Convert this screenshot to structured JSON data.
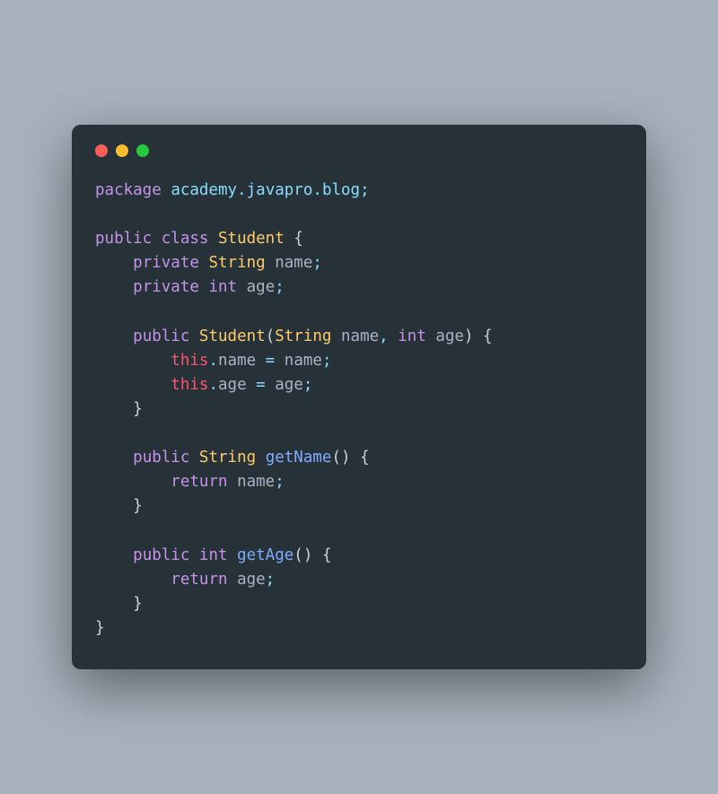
{
  "window": {
    "traffic_lights": [
      "close",
      "minimize",
      "zoom"
    ]
  },
  "code": {
    "tokens": [
      [
        {
          "t": "package",
          "c": "kw"
        },
        {
          "t": " ",
          "c": ""
        },
        {
          "t": "academy",
          "c": "pkg"
        },
        {
          "t": ".",
          "c": "punct"
        },
        {
          "t": "javapro",
          "c": "pkg"
        },
        {
          "t": ".",
          "c": "punct"
        },
        {
          "t": "blog",
          "c": "pkg"
        },
        {
          "t": ";",
          "c": "semi"
        }
      ],
      [],
      [
        {
          "t": "public",
          "c": "kw"
        },
        {
          "t": " ",
          "c": ""
        },
        {
          "t": "class",
          "c": "kw"
        },
        {
          "t": " ",
          "c": ""
        },
        {
          "t": "Student",
          "c": "type"
        },
        {
          "t": " ",
          "c": ""
        },
        {
          "t": "{",
          "c": "brace"
        }
      ],
      [
        {
          "t": "    ",
          "c": ""
        },
        {
          "t": "private",
          "c": "kw"
        },
        {
          "t": " ",
          "c": ""
        },
        {
          "t": "String",
          "c": "type"
        },
        {
          "t": " ",
          "c": ""
        },
        {
          "t": "name",
          "c": "ident"
        },
        {
          "t": ";",
          "c": "semi"
        }
      ],
      [
        {
          "t": "    ",
          "c": ""
        },
        {
          "t": "private",
          "c": "kw"
        },
        {
          "t": " ",
          "c": ""
        },
        {
          "t": "int",
          "c": "kw"
        },
        {
          "t": " ",
          "c": ""
        },
        {
          "t": "age",
          "c": "ident"
        },
        {
          "t": ";",
          "c": "semi"
        }
      ],
      [],
      [
        {
          "t": "    ",
          "c": ""
        },
        {
          "t": "public",
          "c": "kw"
        },
        {
          "t": " ",
          "c": ""
        },
        {
          "t": "Student",
          "c": "type"
        },
        {
          "t": "(",
          "c": "paren"
        },
        {
          "t": "String",
          "c": "type"
        },
        {
          "t": " ",
          "c": ""
        },
        {
          "t": "name",
          "c": "ident"
        },
        {
          "t": ",",
          "c": "punct"
        },
        {
          "t": " ",
          "c": ""
        },
        {
          "t": "int",
          "c": "kw"
        },
        {
          "t": " ",
          "c": ""
        },
        {
          "t": "age",
          "c": "ident"
        },
        {
          "t": ")",
          "c": "paren"
        },
        {
          "t": " ",
          "c": ""
        },
        {
          "t": "{",
          "c": "brace"
        }
      ],
      [
        {
          "t": "        ",
          "c": ""
        },
        {
          "t": "this",
          "c": "this"
        },
        {
          "t": ".",
          "c": "punct"
        },
        {
          "t": "name",
          "c": "ident"
        },
        {
          "t": " ",
          "c": ""
        },
        {
          "t": "=",
          "c": "op"
        },
        {
          "t": " ",
          "c": ""
        },
        {
          "t": "name",
          "c": "ident"
        },
        {
          "t": ";",
          "c": "semi"
        }
      ],
      [
        {
          "t": "        ",
          "c": ""
        },
        {
          "t": "this",
          "c": "this"
        },
        {
          "t": ".",
          "c": "punct"
        },
        {
          "t": "age",
          "c": "ident"
        },
        {
          "t": " ",
          "c": ""
        },
        {
          "t": "=",
          "c": "op"
        },
        {
          "t": " ",
          "c": ""
        },
        {
          "t": "age",
          "c": "ident"
        },
        {
          "t": ";",
          "c": "semi"
        }
      ],
      [
        {
          "t": "    ",
          "c": ""
        },
        {
          "t": "}",
          "c": "brace"
        }
      ],
      [],
      [
        {
          "t": "    ",
          "c": ""
        },
        {
          "t": "public",
          "c": "kw"
        },
        {
          "t": " ",
          "c": ""
        },
        {
          "t": "String",
          "c": "type"
        },
        {
          "t": " ",
          "c": ""
        },
        {
          "t": "getName",
          "c": "method"
        },
        {
          "t": "(",
          "c": "paren"
        },
        {
          "t": ")",
          "c": "paren"
        },
        {
          "t": " ",
          "c": ""
        },
        {
          "t": "{",
          "c": "brace"
        }
      ],
      [
        {
          "t": "        ",
          "c": ""
        },
        {
          "t": "return",
          "c": "kw"
        },
        {
          "t": " ",
          "c": ""
        },
        {
          "t": "name",
          "c": "ident"
        },
        {
          "t": ";",
          "c": "semi"
        }
      ],
      [
        {
          "t": "    ",
          "c": ""
        },
        {
          "t": "}",
          "c": "brace"
        }
      ],
      [],
      [
        {
          "t": "    ",
          "c": ""
        },
        {
          "t": "public",
          "c": "kw"
        },
        {
          "t": " ",
          "c": ""
        },
        {
          "t": "int",
          "c": "kw"
        },
        {
          "t": " ",
          "c": ""
        },
        {
          "t": "getAge",
          "c": "method"
        },
        {
          "t": "(",
          "c": "paren"
        },
        {
          "t": ")",
          "c": "paren"
        },
        {
          "t": " ",
          "c": ""
        },
        {
          "t": "{",
          "c": "brace"
        }
      ],
      [
        {
          "t": "        ",
          "c": ""
        },
        {
          "t": "return",
          "c": "kw"
        },
        {
          "t": " ",
          "c": ""
        },
        {
          "t": "age",
          "c": "ident"
        },
        {
          "t": ";",
          "c": "semi"
        }
      ],
      [
        {
          "t": "    ",
          "c": ""
        },
        {
          "t": "}",
          "c": "brace"
        }
      ],
      [
        {
          "t": "}",
          "c": "brace"
        }
      ]
    ]
  }
}
